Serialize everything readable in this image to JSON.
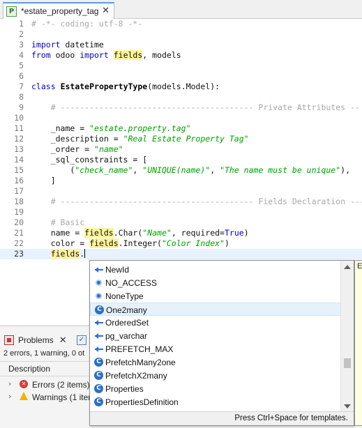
{
  "editor_tab": {
    "title": "*estate_property_tag",
    "icon": "python-file-icon"
  },
  "code_lines": [
    {
      "n": "1",
      "segs": [
        {
          "t": "# -*- coding: utf-8 -*-",
          "c": "comment"
        }
      ]
    },
    {
      "n": "2",
      "segs": []
    },
    {
      "n": "3",
      "segs": [
        {
          "t": "import",
          "c": "kw"
        },
        {
          "t": " datetime",
          "c": ""
        }
      ]
    },
    {
      "n": "4",
      "segs": [
        {
          "t": "from",
          "c": "kw"
        },
        {
          "t": " odoo ",
          "c": ""
        },
        {
          "t": "import",
          "c": "kw"
        },
        {
          "t": " ",
          "c": ""
        },
        {
          "t": "fields",
          "c": "hl"
        },
        {
          "t": ", models",
          "c": ""
        }
      ]
    },
    {
      "n": "5",
      "segs": []
    },
    {
      "n": "6",
      "segs": []
    },
    {
      "n": "7",
      "segs": [
        {
          "t": "class",
          "c": "kw"
        },
        {
          "t": " ",
          "c": ""
        },
        {
          "t": "EstatePropertyType",
          "c": "cls"
        },
        {
          "t": "(models.Model):",
          "c": ""
        }
      ]
    },
    {
      "n": "8",
      "segs": []
    },
    {
      "n": "9",
      "segs": [
        {
          "t": "    # ---------------------------------------- Private Attributes --",
          "c": "comment"
        }
      ]
    },
    {
      "n": "10",
      "segs": []
    },
    {
      "n": "11",
      "segs": [
        {
          "t": "    _name = ",
          "c": ""
        },
        {
          "t": "\"estate.property.tag\"",
          "c": "str"
        }
      ]
    },
    {
      "n": "12",
      "segs": [
        {
          "t": "    _description = ",
          "c": ""
        },
        {
          "t": "\"Real Estate Property Tag\"",
          "c": "str"
        }
      ]
    },
    {
      "n": "13",
      "segs": [
        {
          "t": "    _order = ",
          "c": ""
        },
        {
          "t": "\"name\"",
          "c": "str"
        }
      ]
    },
    {
      "n": "14",
      "segs": [
        {
          "t": "    _sql_constraints = [",
          "c": ""
        }
      ]
    },
    {
      "n": "15",
      "segs": [
        {
          "t": "        (",
          "c": ""
        },
        {
          "t": "\"check_name\"",
          "c": "str"
        },
        {
          "t": ", ",
          "c": ""
        },
        {
          "t": "\"UNIQUE(name)\"",
          "c": "str"
        },
        {
          "t": ", ",
          "c": ""
        },
        {
          "t": "\"The name must be unique\"",
          "c": "str"
        },
        {
          "t": "),",
          "c": ""
        }
      ]
    },
    {
      "n": "16",
      "segs": [
        {
          "t": "    ]",
          "c": ""
        }
      ]
    },
    {
      "n": "17",
      "segs": []
    },
    {
      "n": "18",
      "segs": [
        {
          "t": "    # ---------------------------------------- Fields Declaration ---",
          "c": "comment"
        }
      ]
    },
    {
      "n": "19",
      "segs": []
    },
    {
      "n": "20",
      "segs": [
        {
          "t": "    # Basic",
          "c": "comment"
        }
      ]
    },
    {
      "n": "21",
      "segs": [
        {
          "t": "    name = ",
          "c": ""
        },
        {
          "t": "fields",
          "c": "hl"
        },
        {
          "t": ".Char(",
          "c": ""
        },
        {
          "t": "\"Name\"",
          "c": "str"
        },
        {
          "t": ", required=",
          "c": ""
        },
        {
          "t": "True",
          "c": "kw"
        },
        {
          "t": ")",
          "c": ""
        }
      ]
    },
    {
      "n": "22",
      "segs": [
        {
          "t": "    color = ",
          "c": ""
        },
        {
          "t": "fields",
          "c": "hl"
        },
        {
          "t": ".Integer(",
          "c": ""
        },
        {
          "t": "\"Color Index\"",
          "c": "str"
        },
        {
          "t": ")",
          "c": ""
        }
      ]
    },
    {
      "n": "23",
      "segs": [
        {
          "t": "    ",
          "c": ""
        },
        {
          "t": "fields",
          "c": "hl"
        },
        {
          "t": ".",
          "c": ""
        }
      ],
      "current": true
    }
  ],
  "problems": {
    "tab_label": "Problems",
    "summary": "2 errors, 1 warning, 0 ot",
    "column_header": "Description",
    "rows": [
      {
        "label": "Errors (2 items)",
        "type": "error"
      },
      {
        "label": "Warnings (1 item",
        "type": "warning"
      }
    ]
  },
  "autocomplete": {
    "items": [
      {
        "label": "NewId",
        "icon": "field-icon"
      },
      {
        "label": "NO_ACCESS",
        "icon": "constant-icon"
      },
      {
        "label": "NoneType",
        "icon": "constant-icon"
      },
      {
        "label": "One2many",
        "icon": "class-icon",
        "selected": true
      },
      {
        "label": "OrderedSet",
        "icon": "field-icon"
      },
      {
        "label": "pg_varchar",
        "icon": "field-icon"
      },
      {
        "label": "PREFETCH_MAX",
        "icon": "field-icon"
      },
      {
        "label": "PrefetchMany2one",
        "icon": "class-icon"
      },
      {
        "label": "PrefetchX2many",
        "icon": "class-icon"
      },
      {
        "label": "Properties",
        "icon": "class-icon"
      },
      {
        "label": "PropertiesDefinition",
        "icon": "class-icon"
      }
    ],
    "status_text": "Press Ctrl+Space for templates."
  },
  "doc_pane": {
    "text": "E"
  }
}
